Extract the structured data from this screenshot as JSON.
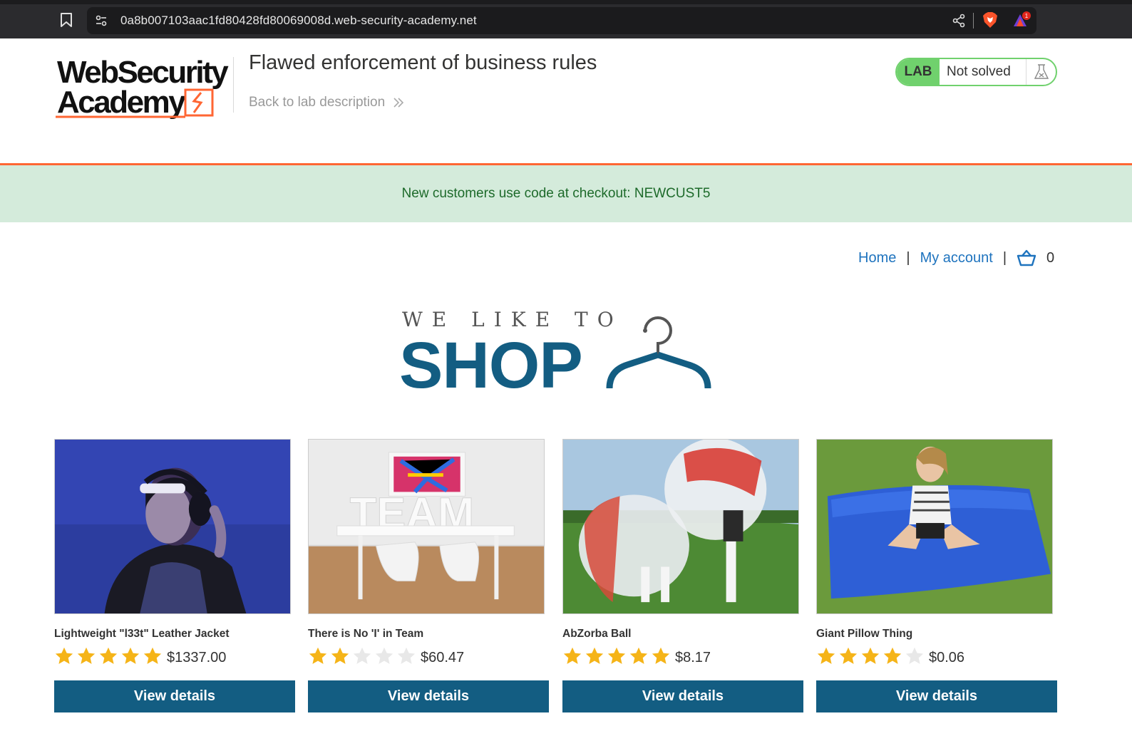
{
  "browser": {
    "url": "0a8b007103aac1fd80428fd80069008d.web-security-academy.net",
    "rewards_badge": "1"
  },
  "lab": {
    "logo_line1": "WebSecurity",
    "logo_line2": "Academy",
    "title": "Flawed enforcement of business rules",
    "back_link": "Back to lab description",
    "badge": "LAB",
    "status": "Not solved"
  },
  "notice": "New customers use code at checkout: NEWCUST5",
  "nav": {
    "home": "Home",
    "separator": "|",
    "account": "My account",
    "cart_count": "0"
  },
  "shop_logo": {
    "tagline": "WE LIKE TO",
    "word": "SHOP"
  },
  "colors": {
    "accent_orange": "#ff6633",
    "lab_green": "#70d16d",
    "button_blue": "#135d82",
    "link_blue": "#1e73be",
    "star_gold": "#f5b418"
  },
  "products": [
    {
      "name": "Lightweight \"l33t\" Leather Jacket",
      "rating": 5,
      "price": "$1337.00",
      "button": "View details"
    },
    {
      "name": "There is No 'I' in Team",
      "rating": 2,
      "price": "$60.47",
      "button": "View details"
    },
    {
      "name": "AbZorba Ball",
      "rating": 5,
      "price": "$8.17",
      "button": "View details"
    },
    {
      "name": "Giant Pillow Thing",
      "rating": 4,
      "price": "$0.06",
      "button": "View details"
    }
  ]
}
